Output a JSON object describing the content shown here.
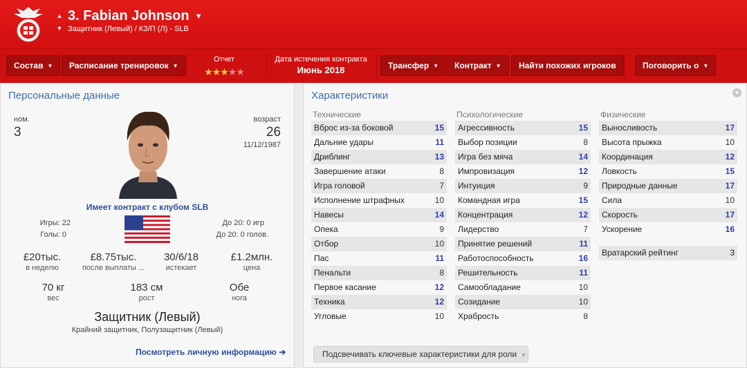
{
  "header": {
    "player_name": "3. Fabian Johnson",
    "subtitle": "Защитник (Левый) / КЗ/П (Л) - SLB"
  },
  "toolbar": {
    "squad": "Состав",
    "training": "Расписание тренировок",
    "report_label": "Отчет",
    "report_stars": 3,
    "report_stars_max": 5,
    "contract_expiry_label": "Дата истечения контракта",
    "contract_expiry_value": "Июнь 2018",
    "transfer": "Трансфер",
    "contract": "Контракт",
    "find_similar": "Найти похожих игроков",
    "talk": "Поговорить о"
  },
  "personal": {
    "title": "Персональные данные",
    "num_label": "ном.",
    "num_value": "3",
    "age_label": "возраст",
    "age_value": "26",
    "dob": "11/12/1987",
    "contract_text": "Имеет контракт с клубом SLB",
    "games": "Игры: 22",
    "goals": "Голы: 0",
    "u20_games": "До 20: 0 игр",
    "u20_goals": "До 20: 0 голов.",
    "wage_value": "£20тыс.",
    "wage_label": "в неделю",
    "after_value": "£8.75тыс.",
    "after_label": "после выплаты ...",
    "expires_value": "30/6/18",
    "expires_label": "истекает",
    "price_value": "£1.2млн.",
    "price_label": "цена",
    "weight_value": "70 кг",
    "weight_label": "вес",
    "height_value": "183 см",
    "height_label": "рост",
    "foot_value": "Обе",
    "foot_label": "нога",
    "position": "Защитник (Левый)",
    "position_roles": "Крайний защитник, Полузащитник (Левый)",
    "view_personal": "Посмотреть личную информацию"
  },
  "attributes": {
    "title": "Характеристики",
    "technical_title": "Технические",
    "mental_title": "Психологические",
    "physical_title": "Физические",
    "technical": [
      {
        "name": "Вброс из-за боковой",
        "value": "15",
        "hi": true
      },
      {
        "name": "Дальние удары",
        "value": "11",
        "hi": true
      },
      {
        "name": "Дриблинг",
        "value": "13",
        "hi": true
      },
      {
        "name": "Завершение атаки",
        "value": "8",
        "hi": false
      },
      {
        "name": "Игра головой",
        "value": "7",
        "hi": false
      },
      {
        "name": "Исполнение штрафных",
        "value": "10",
        "hi": false
      },
      {
        "name": "Навесы",
        "value": "14",
        "hi": true
      },
      {
        "name": "Опека",
        "value": "9",
        "hi": false
      },
      {
        "name": "Отбор",
        "value": "10",
        "hi": false
      },
      {
        "name": "Пас",
        "value": "11",
        "hi": true
      },
      {
        "name": "Пенальти",
        "value": "8",
        "hi": false
      },
      {
        "name": "Первое касание",
        "value": "12",
        "hi": true
      },
      {
        "name": "Техника",
        "value": "12",
        "hi": true
      },
      {
        "name": "Угловые",
        "value": "10",
        "hi": false
      }
    ],
    "mental": [
      {
        "name": "Агрессивность",
        "value": "15",
        "hi": true
      },
      {
        "name": "Выбор позиции",
        "value": "8",
        "hi": false
      },
      {
        "name": "Игра без мяча",
        "value": "14",
        "hi": true
      },
      {
        "name": "Импровизация",
        "value": "12",
        "hi": true
      },
      {
        "name": "Интуиция",
        "value": "9",
        "hi": false
      },
      {
        "name": "Командная игра",
        "value": "15",
        "hi": true
      },
      {
        "name": "Концентрация",
        "value": "12",
        "hi": true
      },
      {
        "name": "Лидерство",
        "value": "7",
        "hi": false
      },
      {
        "name": "Принятие решений",
        "value": "11",
        "hi": true
      },
      {
        "name": "Работоспособность",
        "value": "16",
        "hi": true
      },
      {
        "name": "Решительность",
        "value": "11",
        "hi": true
      },
      {
        "name": "Самообладание",
        "value": "10",
        "hi": false
      },
      {
        "name": "Созидание",
        "value": "10",
        "hi": false
      },
      {
        "name": "Храбрость",
        "value": "8",
        "hi": false
      }
    ],
    "physical": [
      {
        "name": "Выносливость",
        "value": "17",
        "hi": true
      },
      {
        "name": "Высота прыжка",
        "value": "10",
        "hi": false
      },
      {
        "name": "Координация",
        "value": "12",
        "hi": true
      },
      {
        "name": "Ловкость",
        "value": "15",
        "hi": true
      },
      {
        "name": "Природные данные",
        "value": "17",
        "hi": true
      },
      {
        "name": "Сила",
        "value": "10",
        "hi": false
      },
      {
        "name": "Скорость",
        "value": "17",
        "hi": true
      },
      {
        "name": "Ускорение",
        "value": "16",
        "hi": true
      }
    ],
    "gk_label": "Вратарский рейтинг",
    "gk_value": "3",
    "role_button": "Подсвечивать ключевые характеристики для роли"
  },
  "colors": {
    "header_red": "#d90f0f",
    "button_red": "#a70d0d",
    "highlight_blue": "#2e3fae",
    "title_blue": "#3c6ea8"
  }
}
